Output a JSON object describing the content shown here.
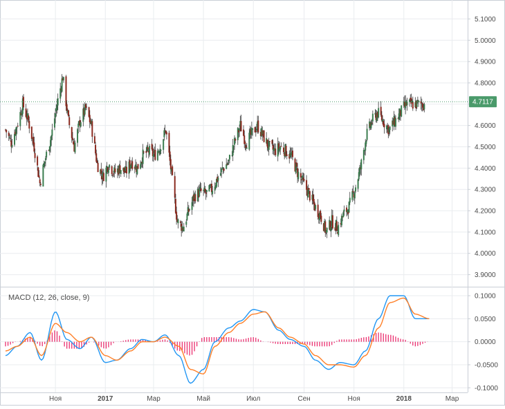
{
  "colors": {
    "background": "#ffffff",
    "grid": "#e9ecef",
    "border": "#c9ced6",
    "axis_text": "#4a4a4a",
    "candle_up": "#3b7d4f",
    "candle_down": "#8a2a1f",
    "wick": "#3a3a3a",
    "last_price_line": "#4a9a6a",
    "last_price_badge": "#4a9a6a",
    "macd_line": "#2196f3",
    "signal_line": "#ff7f27",
    "histogram": "#e91e63"
  },
  "chart_data": [
    {
      "type": "candlestick",
      "x_tick_labels": [
        "Ноя",
        "2017",
        "Мар",
        "Май",
        "Июл",
        "Сен",
        "Ноя",
        "2018",
        "Мар"
      ],
      "x_tick_values": [
        "2016-11-01",
        "2017-01-01",
        "2017-03-01",
        "2017-05-01",
        "2017-07-01",
        "2017-09-01",
        "2017-11-01",
        "2018-01-01",
        "2018-03-01"
      ],
      "x_range": [
        "2016-09-01",
        "2018-03-20"
      ],
      "y_tick_labels": [
        "3.9000",
        "4.0000",
        "4.1000",
        "4.2000",
        "4.3000",
        "4.4000",
        "4.5000",
        "4.6000",
        "4.7000",
        "4.8000",
        "4.9000",
        "5.0000",
        "5.1000"
      ],
      "ylim": [
        3.85,
        5.15
      ],
      "grid": true,
      "last_price": 4.7117,
      "last_price_label": "4.7117",
      "series": [
        {
          "values_path": [
            [
              "2016-09-01",
              4.58
            ],
            [
              "2016-09-08",
              4.52
            ],
            [
              "2016-09-15",
              4.6
            ],
            [
              "2016-09-22",
              4.7
            ],
            [
              "2016-09-29",
              4.62
            ],
            [
              "2016-10-06",
              4.5
            ],
            [
              "2016-10-13",
              4.33
            ],
            [
              "2016-10-20",
              4.45
            ],
            [
              "2016-10-27",
              4.55
            ],
            [
              "2016-11-03",
              4.7
            ],
            [
              "2016-11-10",
              4.83
            ],
            [
              "2016-11-17",
              4.62
            ],
            [
              "2016-11-24",
              4.5
            ],
            [
              "2016-12-01",
              4.62
            ],
            [
              "2016-12-08",
              4.68
            ],
            [
              "2016-12-15",
              4.6
            ],
            [
              "2016-12-22",
              4.42
            ],
            [
              "2016-12-29",
              4.36
            ],
            [
              "2017-01-05",
              4.42
            ],
            [
              "2017-01-12",
              4.38
            ],
            [
              "2017-01-19",
              4.4
            ],
            [
              "2017-01-26",
              4.38
            ],
            [
              "2017-02-02",
              4.43
            ],
            [
              "2017-02-09",
              4.4
            ],
            [
              "2017-02-16",
              4.46
            ],
            [
              "2017-02-23",
              4.48
            ],
            [
              "2017-03-02",
              4.46
            ],
            [
              "2017-03-09",
              4.5
            ],
            [
              "2017-03-16",
              4.58
            ],
            [
              "2017-03-23",
              4.37
            ],
            [
              "2017-03-30",
              4.15
            ],
            [
              "2017-04-06",
              4.12
            ],
            [
              "2017-04-13",
              4.2
            ],
            [
              "2017-04-20",
              4.27
            ],
            [
              "2017-04-27",
              4.29
            ],
            [
              "2017-05-04",
              4.28
            ],
            [
              "2017-05-11",
              4.3
            ],
            [
              "2017-05-18",
              4.35
            ],
            [
              "2017-05-25",
              4.4
            ],
            [
              "2017-06-01",
              4.43
            ],
            [
              "2017-06-08",
              4.52
            ],
            [
              "2017-06-15",
              4.6
            ],
            [
              "2017-06-22",
              4.52
            ],
            [
              "2017-06-29",
              4.56
            ],
            [
              "2017-07-06",
              4.6
            ],
            [
              "2017-07-13",
              4.55
            ],
            [
              "2017-07-20",
              4.5
            ],
            [
              "2017-07-27",
              4.48
            ],
            [
              "2017-08-03",
              4.5
            ],
            [
              "2017-08-10",
              4.48
            ],
            [
              "2017-08-17",
              4.45
            ],
            [
              "2017-08-24",
              4.38
            ],
            [
              "2017-08-31",
              4.33
            ],
            [
              "2017-09-07",
              4.28
            ],
            [
              "2017-09-14",
              4.22
            ],
            [
              "2017-09-21",
              4.18
            ],
            [
              "2017-09-28",
              4.1
            ],
            [
              "2017-10-05",
              4.15
            ],
            [
              "2017-10-12",
              4.12
            ],
            [
              "2017-10-19",
              4.18
            ],
            [
              "2017-10-26",
              4.22
            ],
            [
              "2017-11-02",
              4.3
            ],
            [
              "2017-11-09",
              4.4
            ],
            [
              "2017-11-16",
              4.55
            ],
            [
              "2017-11-23",
              4.62
            ],
            [
              "2017-11-30",
              4.66
            ],
            [
              "2017-12-07",
              4.62
            ],
            [
              "2017-12-14",
              4.58
            ],
            [
              "2017-12-21",
              4.62
            ],
            [
              "2017-12-28",
              4.66
            ],
            [
              "2018-01-04",
              4.7
            ]
          ]
        }
      ]
    },
    {
      "type": "line",
      "title": "MACD (12, 26, close, 9)",
      "x_range": [
        "2016-09-01",
        "2018-03-20"
      ],
      "y_tick_labels": [
        "-0.1000",
        "-0.0500",
        "0.0000",
        "0.0500",
        "0.1000"
      ],
      "ylim": [
        -0.11,
        0.115
      ],
      "grid": true,
      "x": [
        "2016-09-01",
        "2016-09-15",
        "2016-10-01",
        "2016-10-15",
        "2016-11-01",
        "2016-11-15",
        "2016-12-01",
        "2016-12-15",
        "2017-01-01",
        "2017-01-15",
        "2017-02-01",
        "2017-02-15",
        "2017-03-01",
        "2017-03-15",
        "2017-04-01",
        "2017-04-15",
        "2017-05-01",
        "2017-05-15",
        "2017-06-01",
        "2017-06-15",
        "2017-07-01",
        "2017-07-15",
        "2017-08-01",
        "2017-08-15",
        "2017-09-01",
        "2017-09-15",
        "2017-10-01",
        "2017-10-15",
        "2017-11-01",
        "2017-11-15",
        "2017-12-01",
        "2017-12-15",
        "2018-01-01",
        "2018-01-15",
        "2018-02-01"
      ],
      "series": [
        {
          "key": "macd",
          "values": [
            -0.03,
            -0.01,
            0.02,
            -0.04,
            0.065,
            0.005,
            -0.015,
            0.01,
            -0.045,
            -0.04,
            -0.015,
            0.005,
            0.0,
            0.015,
            -0.03,
            -0.09,
            -0.06,
            0.0,
            0.03,
            0.045,
            0.07,
            0.065,
            0.025,
            0.005,
            -0.01,
            -0.04,
            -0.06,
            -0.045,
            -0.05,
            -0.02,
            0.05,
            0.1,
            0.1,
            0.05,
            0.05
          ]
        },
        {
          "key": "signal",
          "values": [
            -0.02,
            -0.01,
            0.01,
            -0.03,
            0.04,
            0.02,
            0.0,
            0.01,
            -0.03,
            -0.04,
            -0.02,
            0.0,
            0.0,
            0.01,
            -0.01,
            -0.06,
            -0.07,
            -0.01,
            0.02,
            0.04,
            0.06,
            0.065,
            0.03,
            0.01,
            -0.005,
            -0.03,
            -0.05,
            -0.05,
            -0.055,
            -0.03,
            0.03,
            0.085,
            0.095,
            0.06,
            0.05
          ]
        },
        {
          "key": "histogram",
          "values": [
            -0.01,
            0.0,
            0.01,
            -0.01,
            0.025,
            -0.015,
            -0.015,
            0.0,
            -0.015,
            0.0,
            0.005,
            0.005,
            0.0,
            0.005,
            -0.02,
            -0.03,
            0.01,
            0.01,
            0.01,
            0.005,
            0.01,
            0.0,
            -0.005,
            -0.005,
            -0.005,
            -0.01,
            -0.01,
            0.005,
            0.005,
            0.01,
            0.02,
            0.015,
            0.005,
            -0.01,
            0.0
          ]
        }
      ]
    }
  ]
}
